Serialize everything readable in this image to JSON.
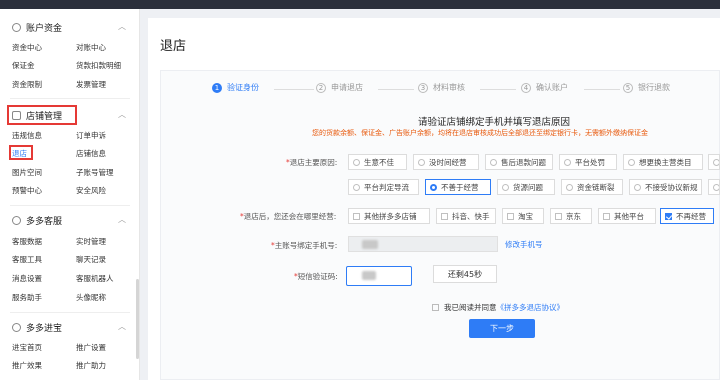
{
  "sidebar": {
    "sections": [
      {
        "title": "账户资金",
        "items": [
          "资金中心",
          "对账中心",
          "保证金",
          "货款扣款明细",
          "资金限制",
          "发票管理"
        ]
      },
      {
        "title": "店铺管理",
        "items": [
          "违规信息",
          "订单申诉",
          "退店",
          "店铺信息",
          "图片空间",
          "子账号管理",
          "预警中心",
          "安全风险"
        ]
      },
      {
        "title": "多多客服",
        "items": [
          "客服数据",
          "实时管理",
          "客服工具",
          "聊天记录",
          "消息设置",
          "客服机器人",
          "服务助手",
          "头像昵称"
        ]
      },
      {
        "title": "多多进宝",
        "items": [
          "进宝首页",
          "推广设置",
          "推广效果",
          "推广助力"
        ]
      }
    ],
    "active_item": "退店"
  },
  "page": {
    "title": "退店"
  },
  "steps": [
    {
      "num": "1",
      "label": "验证身份",
      "active": true
    },
    {
      "num": "2",
      "label": "申请退店",
      "active": false
    },
    {
      "num": "3",
      "label": "材料审核",
      "active": false
    },
    {
      "num": "4",
      "label": "确认账户",
      "active": false
    },
    {
      "num": "5",
      "label": "银行退款",
      "active": false
    }
  ],
  "form": {
    "headline": "请验证店铺绑定手机并填写退店原因",
    "warning": "您的货款余额、保证金、广告账户余额，均将在退店审核成功后全部退还至绑定银行卡，无需额外缴纳保证金",
    "reason": {
      "label": "退店主要原因:",
      "options": [
        "生意不佳",
        "没时间经营",
        "售后退款问题",
        "平台处罚",
        "想更换主营类目",
        "平台判定导流",
        "不善于经营",
        "货源问题",
        "资金链断裂",
        "不接受协议新规"
      ],
      "selected": "不善于经营"
    },
    "future": {
      "label": "退店后，您还会在哪里经营:",
      "options": [
        "其他拼多多店铺",
        "抖音、快手",
        "淘宝",
        "京东",
        "其他平台",
        "不再经营"
      ],
      "selected": "不再经营"
    },
    "phone": {
      "label": "主账号绑定手机号:",
      "modify_link": "修改手机号"
    },
    "sms": {
      "label": "短信验证码:",
      "resend": "还剩45秒"
    },
    "agreement": {
      "prefix": "我已阅读并同意",
      "link": "《拼多多退店协议》"
    },
    "next": "下一步"
  },
  "colors": {
    "accent": "#2e7cf6",
    "warning": "#e8590c",
    "highlight": "#e53935"
  }
}
